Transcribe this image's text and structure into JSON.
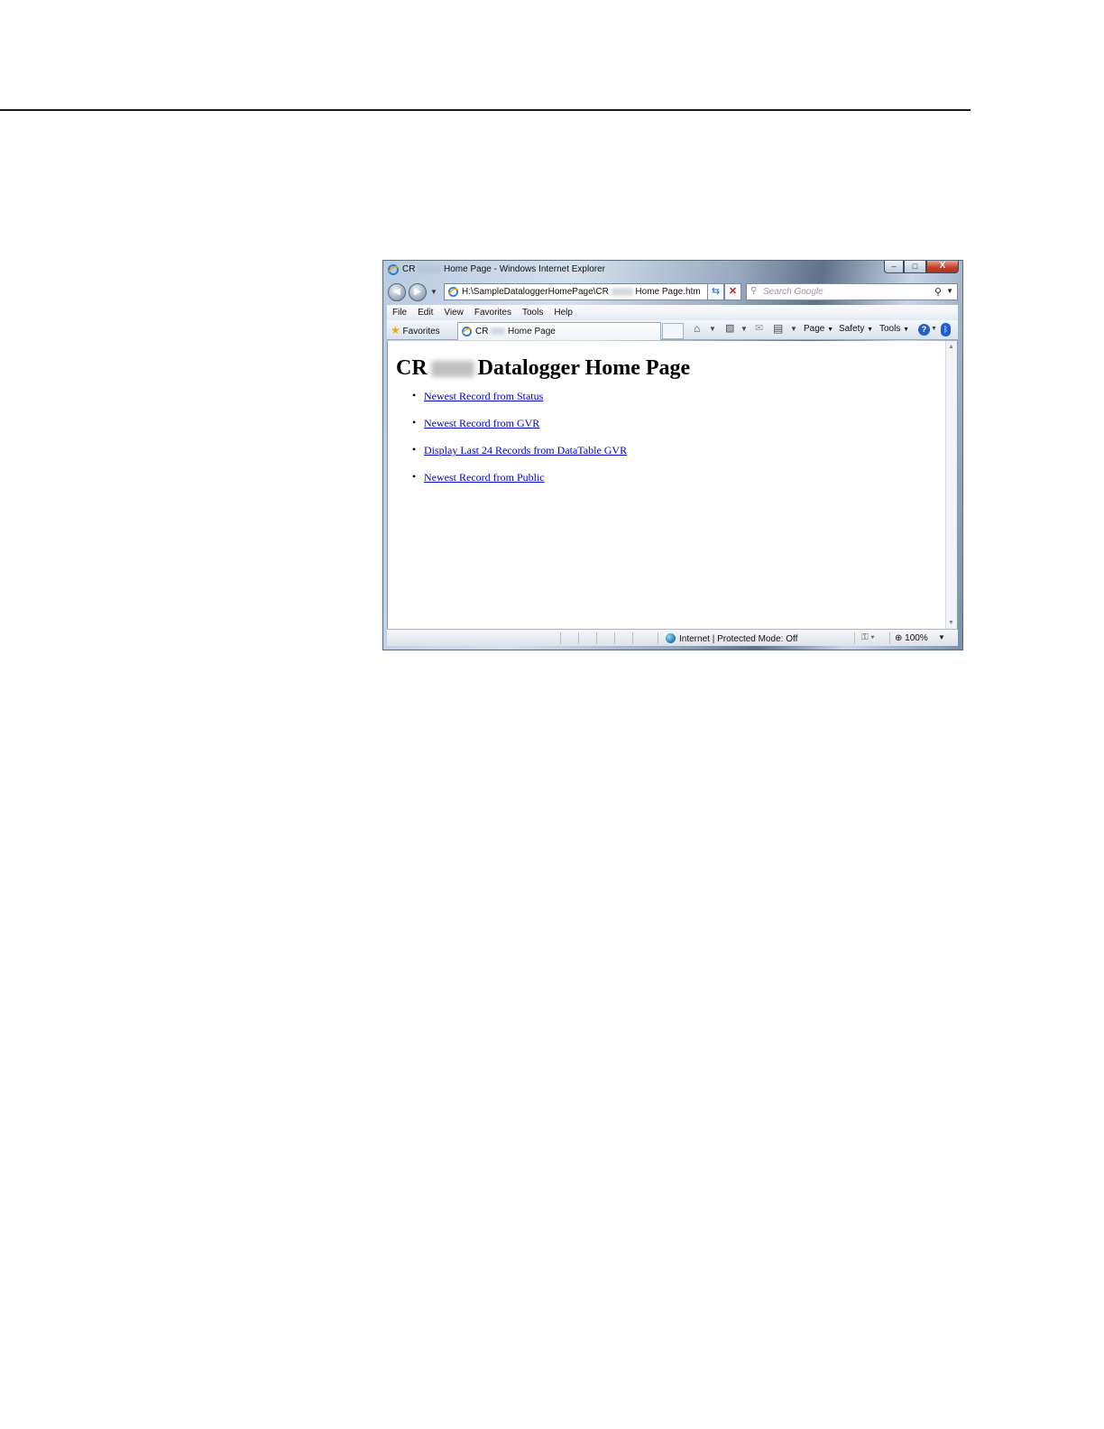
{
  "window": {
    "title_prefix": "CR",
    "title_suffix": "Home Page - Windows Internet Explorer",
    "buttons": {
      "minimize": "–",
      "maximize": "□",
      "close": "X"
    }
  },
  "navigation": {
    "address_prefix": "H:\\SampleDataloggerHomePage\\CR",
    "address_suffix": "Home Page.htm",
    "search_placeholder": "Search Google"
  },
  "menu": [
    "File",
    "Edit",
    "View",
    "Favorites",
    "Tools",
    "Help"
  ],
  "command_bar": {
    "favorites_label": "Favorites",
    "tab_prefix": "CR",
    "tab_suffix": "Home Page",
    "page_label": "Page",
    "safety_label": "Safety",
    "tools_label": "Tools"
  },
  "content": {
    "heading_prefix": "CR",
    "heading_suffix": "Datalogger Home Page",
    "links": [
      "Newest Record from Status",
      "Newest Record from GVR",
      "Display Last 24 Records from DataTable GVR",
      "Newest Record from Public"
    ]
  },
  "status_bar": {
    "zone": "Internet | Protected Mode: Off",
    "zoom": "100%"
  }
}
